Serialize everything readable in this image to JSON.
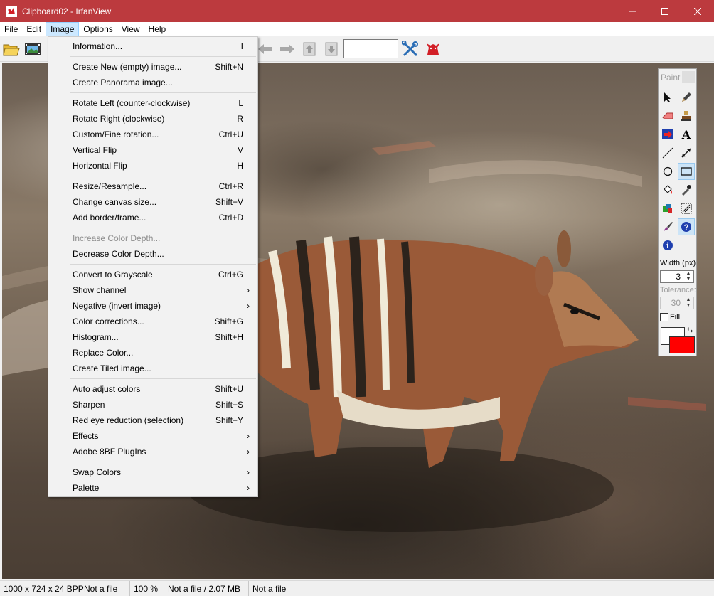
{
  "window": {
    "title": "Clipboard02 - IrfanView",
    "minimize_icon": "minimize-icon",
    "maximize_icon": "maximize-icon",
    "close_icon": "close-icon"
  },
  "menubar": {
    "items": [
      "File",
      "Edit",
      "Image",
      "Options",
      "View",
      "Help"
    ],
    "active": "Image"
  },
  "toolbar": {
    "zoom_value": "",
    "icons": [
      "open-folder-icon",
      "slideshow-icon",
      "previous-arrow-icon",
      "next-arrow-icon",
      "page-up-icon",
      "page-down-icon",
      "settings-tools-icon",
      "irfanview-cat-icon"
    ]
  },
  "image_menu": {
    "items": [
      {
        "label": "Information...",
        "shortcut": "I"
      },
      {
        "label": "Create New (empty) image...",
        "shortcut": "Shift+N"
      },
      {
        "label": "Create Panorama image...",
        "shortcut": ""
      },
      {
        "label": "Rotate Left (counter-clockwise)",
        "shortcut": "L"
      },
      {
        "label": "Rotate Right (clockwise)",
        "shortcut": "R"
      },
      {
        "label": "Custom/Fine rotation...",
        "shortcut": "Ctrl+U"
      },
      {
        "label": "Vertical Flip",
        "shortcut": "V"
      },
      {
        "label": "Horizontal Flip",
        "shortcut": "H"
      },
      {
        "label": "Resize/Resample...",
        "shortcut": "Ctrl+R"
      },
      {
        "label": "Change canvas size...",
        "shortcut": "Shift+V"
      },
      {
        "label": "Add border/frame...",
        "shortcut": "Ctrl+D"
      },
      {
        "label": "Increase Color Depth...",
        "shortcut": "",
        "disabled": true
      },
      {
        "label": "Decrease Color Depth...",
        "shortcut": ""
      },
      {
        "label": "Convert to Grayscale",
        "shortcut": "Ctrl+G"
      },
      {
        "label": "Show channel",
        "shortcut": "",
        "submenu": true
      },
      {
        "label": "Negative (invert image)",
        "shortcut": "",
        "submenu": true
      },
      {
        "label": "Color corrections...",
        "shortcut": "Shift+G"
      },
      {
        "label": "Histogram...",
        "shortcut": "Shift+H"
      },
      {
        "label": "Replace Color...",
        "shortcut": ""
      },
      {
        "label": "Create Tiled image...",
        "shortcut": ""
      },
      {
        "label": "Auto adjust colors",
        "shortcut": "Shift+U"
      },
      {
        "label": "Sharpen",
        "shortcut": "Shift+S"
      },
      {
        "label": "Red eye reduction (selection)",
        "shortcut": "Shift+Y"
      },
      {
        "label": "Effects",
        "shortcut": "",
        "submenu": true
      },
      {
        "label": "Adobe 8BF PlugIns",
        "shortcut": "",
        "submenu": true
      },
      {
        "label": "Swap Colors",
        "shortcut": "",
        "submenu": true
      },
      {
        "label": "Palette",
        "shortcut": "",
        "submenu": true
      }
    ]
  },
  "paint": {
    "title": "Paint",
    "tools": [
      "select-arrow-icon",
      "pencil-icon",
      "eraser-icon",
      "clone-stamp-icon",
      "arrow-box-icon",
      "text-tool-icon",
      "line-icon",
      "double-arrow-icon",
      "ellipse-icon",
      "rectangle-icon",
      "fill-bucket-icon",
      "eyedropper-icon",
      "color-replace-icon",
      "selection-pattern-icon",
      "brush-icon",
      "help-icon",
      "info-icon"
    ],
    "selected_tool": "rectangle-icon",
    "width_label": "Width (px)",
    "width_value": "3",
    "tolerance_label": "Tolerance:",
    "tolerance_value": "30",
    "fill_label": "Fill",
    "fill_checked": false,
    "foreground_color": "#ff0000",
    "background_color": "#ffffff"
  },
  "statusbar": {
    "dimensions": "1000 x 724 x 24 BPP",
    "file_index": "Not a file",
    "zoom": "100 %",
    "file_size": "Not a file / 2.07 MB",
    "date": "Not a file"
  },
  "colors": {
    "titlebar": "#bc3a3e",
    "menu_highlight": "#cce8ff"
  }
}
